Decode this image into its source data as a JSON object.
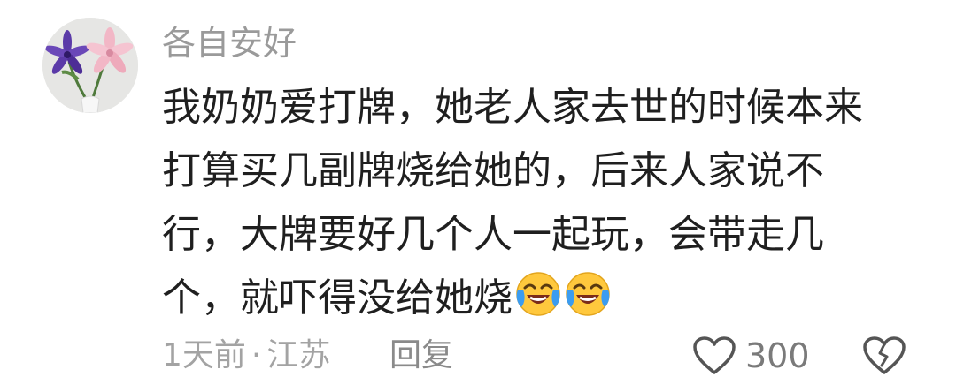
{
  "comment": {
    "username": "各自安好",
    "body_lines": [
      "我奶奶爱打牌，她老人家去世的时候本来",
      "打算买几副牌烧给她的，后来人家说不",
      "行，大牌要好几个人一起玩，会带走几",
      "个，就吓得没给她烧"
    ],
    "emojis": [
      "laughing-crying-emoji",
      "laughing-crying-emoji"
    ],
    "time": "1天前",
    "separator": "·",
    "location": "江苏",
    "reply_label": "回复",
    "like_count": "300",
    "icons": {
      "like": "heart-outline-icon",
      "dislike": "broken-heart-icon"
    },
    "colors": {
      "username": "#9a9a9a",
      "body": "#1f1f1f",
      "meta": "#a3a3a3",
      "emoji_face": "#ffc83d",
      "emoji_tears": "#3b9cf0"
    }
  }
}
